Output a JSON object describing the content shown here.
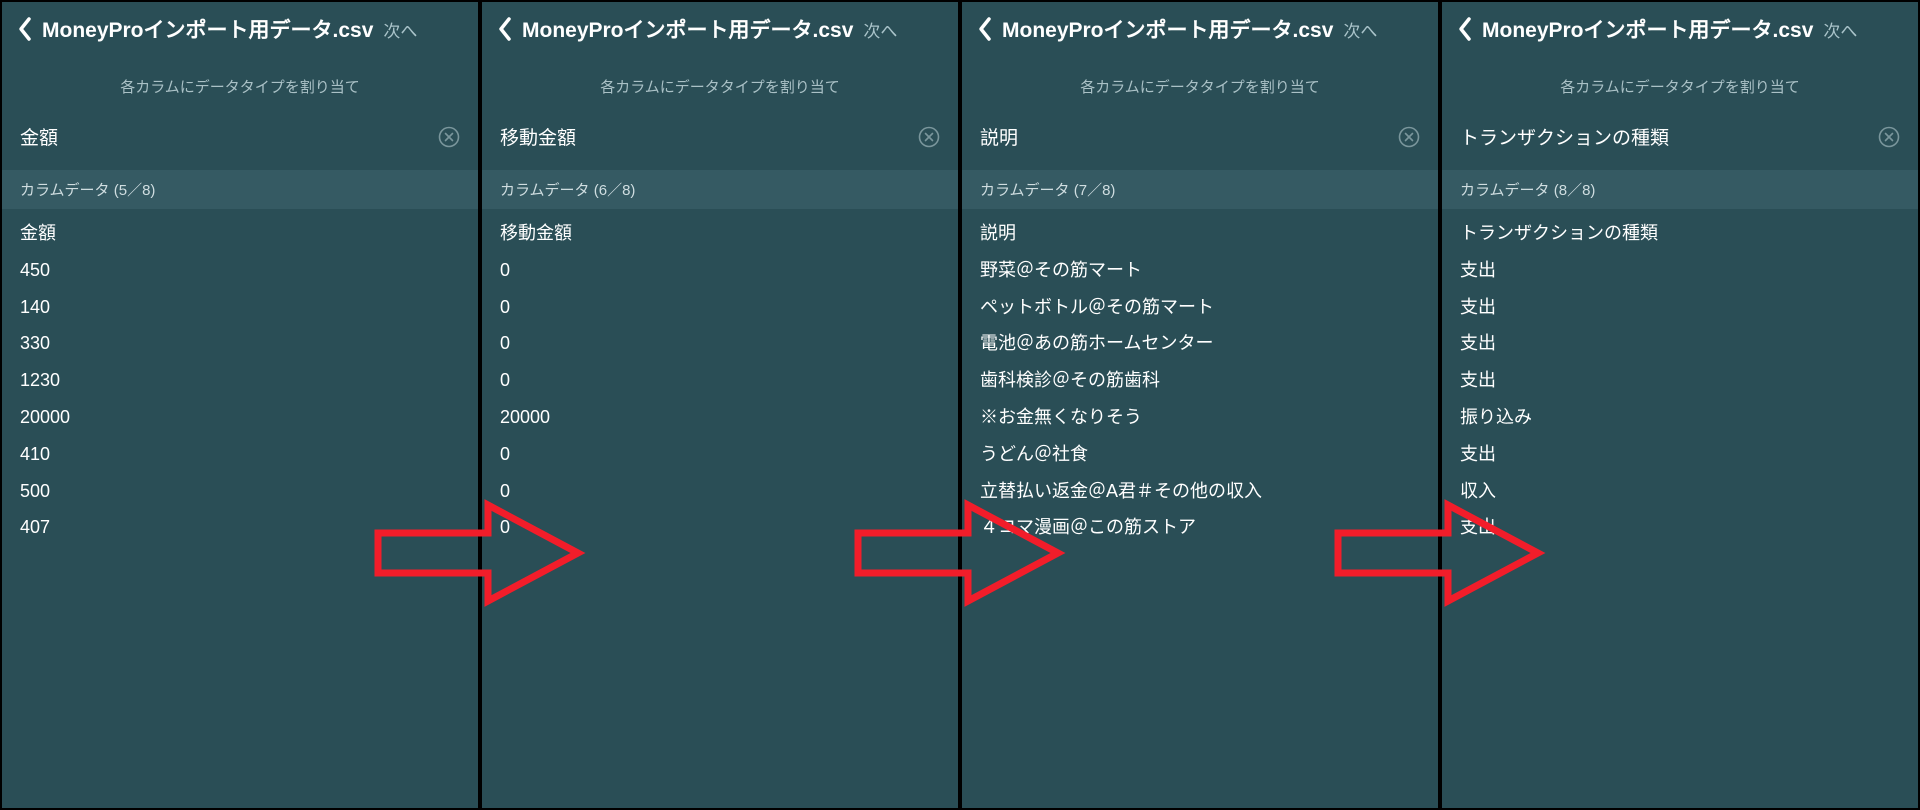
{
  "common": {
    "filename": "MoneyProインポート用データ.csv",
    "next_label": "次へ",
    "subtitle": "各カラムにデータタイプを割り当て",
    "column_data_prefix": "カラムデータ"
  },
  "panels": [
    {
      "type_label": "金額",
      "column_index": "5／8",
      "rows": [
        "金額",
        "450",
        "140",
        "330",
        "1230",
        "20000",
        "410",
        "500",
        "407"
      ]
    },
    {
      "type_label": "移動金額",
      "column_index": "6／8",
      "rows": [
        "移動金額",
        "0",
        "0",
        "0",
        "0",
        "20000",
        "0",
        "0",
        "0"
      ]
    },
    {
      "type_label": "説明",
      "column_index": "7／8",
      "rows": [
        "説明",
        "野菜＠その筋マート",
        "ペットボトル＠その筋マート",
        "電池＠あの筋ホームセンター",
        "歯科検診＠その筋歯科",
        "※お金無くなりそう",
        "うどん＠社食",
        "立替払い返金＠A君＃その他の収入",
        "４コマ漫画＠この筋ストア"
      ]
    },
    {
      "type_label": "トランザクションの種類",
      "column_index": "8／8",
      "rows": [
        "トランザクションの種類",
        "支出",
        "支出",
        "支出",
        "支出",
        "振り込み",
        "支出",
        "収入",
        "支出"
      ]
    }
  ]
}
